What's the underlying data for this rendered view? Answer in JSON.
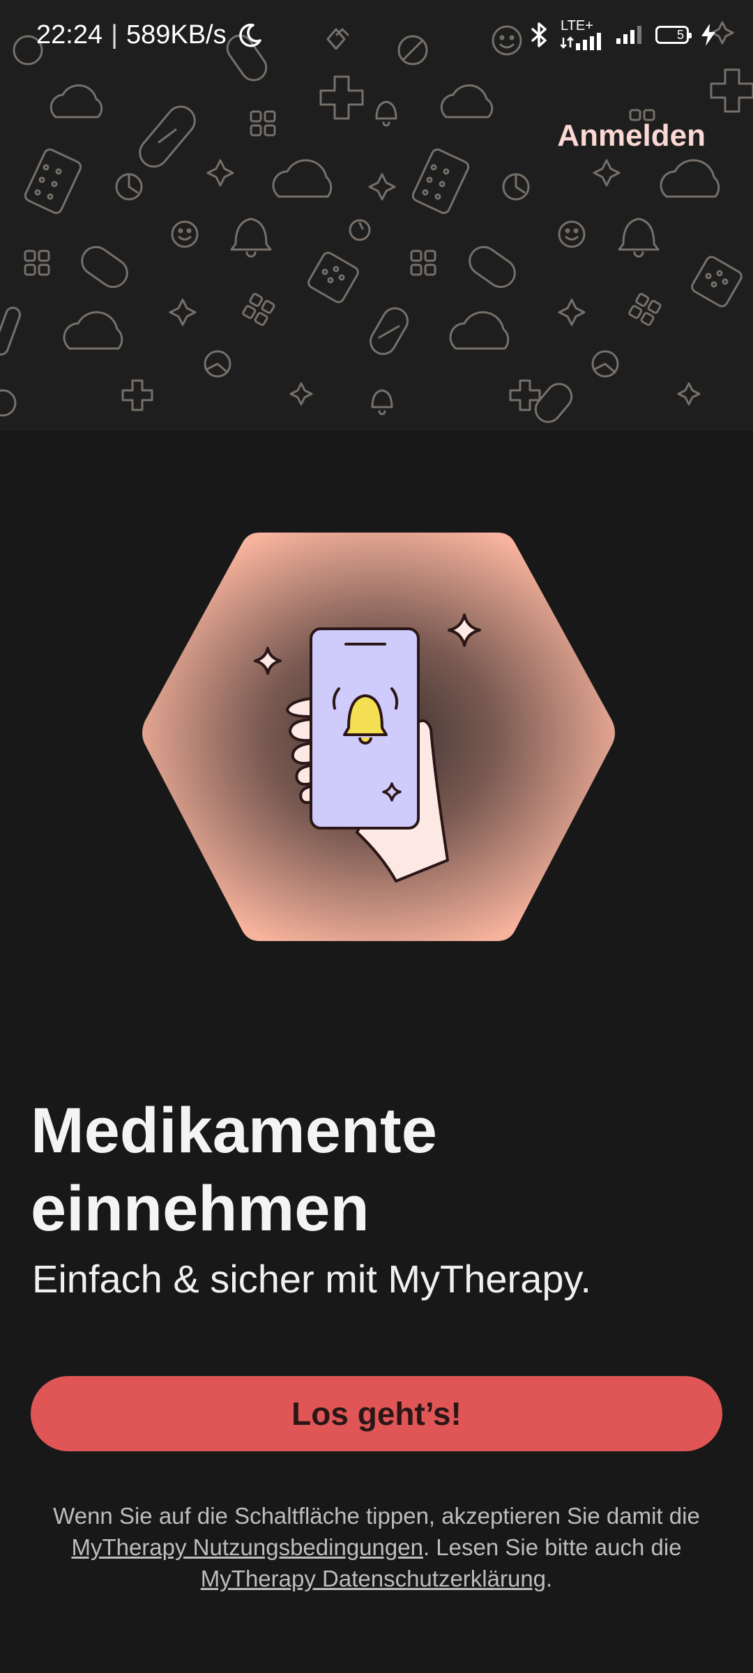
{
  "status_bar": {
    "time": "22:24",
    "net_speed": "589KB/s",
    "network_label": "LTE+",
    "battery_level": "5"
  },
  "icons": {
    "moon": "moon-icon",
    "bluetooth": "bluetooth-icon",
    "signal": "signal-icon",
    "battery": "battery-icon",
    "charging": "charging-icon"
  },
  "header": {
    "signin_label": "Anmelden"
  },
  "onboarding": {
    "title_line1": "Medikamente",
    "title_line2": "einnehmen",
    "subtitle": "Einfach & sicher mit MyTherapy."
  },
  "cta": {
    "label": "Los geht’s!"
  },
  "legal": {
    "text_before": "Wenn Sie auf die Schaltfläche tippen, akzeptieren Sie damit die ",
    "terms_link": "MyTherapy Nutzungsbedingungen",
    "text_middle": ". Lesen Sie bitte auch die ",
    "privacy_link": "MyTherapy Datenschutzerklärung",
    "text_after": "."
  },
  "colors": {
    "background": "#181818",
    "header_background": "#1e1e1e",
    "pattern_stroke": "#77706a",
    "accent": "#e05656",
    "signin_text": "#fbd8d3",
    "hexagon": "#f7b39d",
    "phone_screen": "#cfcbfa",
    "bell": "#f4de52"
  }
}
